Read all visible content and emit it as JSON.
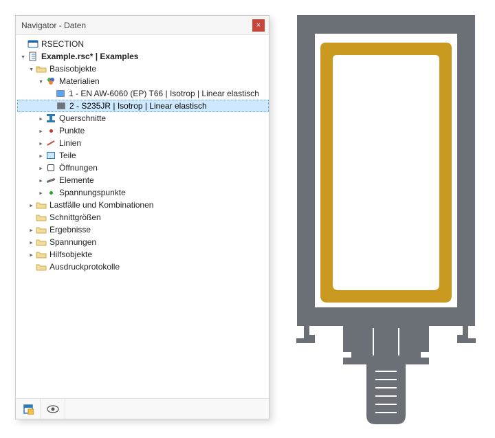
{
  "window": {
    "title": "Navigator - Daten",
    "close_glyph": "×"
  },
  "root": {
    "app_name": "RSECTION",
    "file_label": "Example.rsc* | Examples"
  },
  "tree": {
    "basisobjekte": "Basisobjekte",
    "materialien": "Materialien",
    "material_1": "1 - EN AW-6060 (EP) T66 | Isotrop | Linear elastisch",
    "material_2": "2 - S235JR | Isotrop | Linear elastisch",
    "querschnitte": "Querschnitte",
    "punkte": "Punkte",
    "linien": "Linien",
    "teile": "Teile",
    "oeffnungen": "Öffnungen",
    "elemente": "Elemente",
    "spannungspunkte": "Spannungspunkte",
    "lastfaelle": "Lastfälle und Kombinationen",
    "schnittgroessen": "Schnittgrößen",
    "ergebnisse": "Ergebnisse",
    "spannungen": "Spannungen",
    "hilfsobjekte": "Hilfsobjekte",
    "ausdruckprotokolle": "Ausdruckprotokolle"
  },
  "colors": {
    "outer_profile": "#6b7076",
    "inner_profile": "#c99a1f"
  }
}
